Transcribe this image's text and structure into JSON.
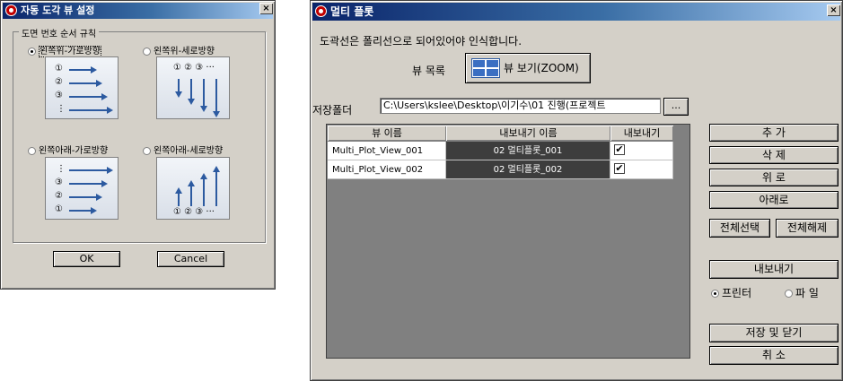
{
  "dialog1": {
    "title": "자동 도각 뷰 설정",
    "group_title": "도면 번호 순서 규칙",
    "options": [
      {
        "label": "왼쪽위-가로방향",
        "selected": true
      },
      {
        "label": "왼쪽위-세로방향",
        "selected": false
      },
      {
        "label": "왼쪽아래-가로방향",
        "selected": false
      },
      {
        "label": "왼쪽아래-세로방향",
        "selected": false
      }
    ],
    "pic_markers": {
      "top_left": [
        "①",
        "②",
        "③",
        "⋮"
      ],
      "top_right": "① ② ③ ···",
      "bottom_left": [
        "⋮",
        "③",
        "②",
        "①"
      ],
      "bottom_right": "① ② ③ ···"
    },
    "ok_label": "OK",
    "cancel_label": "Cancel"
  },
  "dialog2": {
    "title": "멀티 플롯",
    "notice": "도곽선은 폴리선으로 되어있어야 인식합니다.",
    "view_list_label": "뷰 목록",
    "view_zoom_button": "뷰 보기(ZOOM)",
    "save_folder_label": "저장폴더",
    "save_folder_value": "C:\\Users\\kslee\\Desktop\\이기수\\01 진행(프로젝트",
    "browse_label": "...",
    "table": {
      "headers": [
        "뷰 이름",
        "내보내기 이름",
        "내보내기"
      ],
      "rows": [
        {
          "view": "Multi_Plot_View_001",
          "export_name": "02 멀티플롯_001",
          "export": true
        },
        {
          "view": "Multi_Plot_View_002",
          "export_name": "02 멀티플롯_002",
          "export": true
        }
      ]
    },
    "buttons": {
      "add": "추 가",
      "delete": "삭 제",
      "up": "위 로",
      "down": "아래로",
      "select_all": "전체선택",
      "deselect_all": "전체해제",
      "export": "내보내기",
      "save_close": "저장 및 닫기",
      "cancel": "취 소"
    },
    "output": {
      "printer": "프린터",
      "file": "파 일",
      "selected": "printer"
    }
  },
  "close_glyph": "×"
}
